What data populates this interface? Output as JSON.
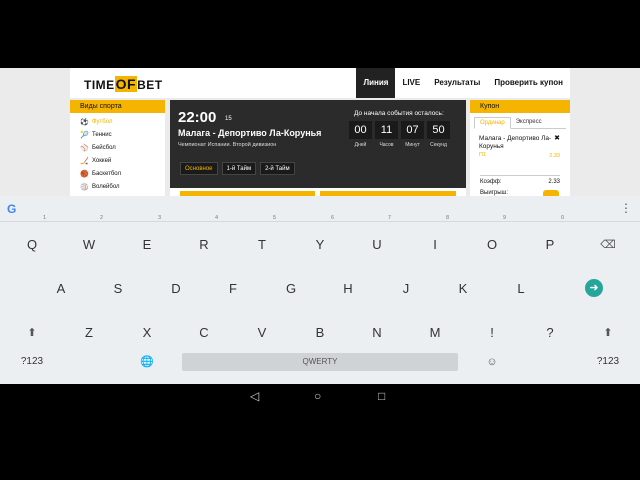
{
  "site": {
    "logo_pre": "TIME",
    "logo_mid": "OF",
    "logo_post": "BET",
    "nav": [
      "Линия",
      "LIVE",
      "Результаты",
      "Проверить купон"
    ]
  },
  "sidebar": {
    "title": "Виды спорта",
    "items": [
      {
        "icon": "soccer-ball-icon",
        "label": "Футбол"
      },
      {
        "icon": "tennis-icon",
        "label": "Теннис"
      },
      {
        "icon": "baseball-icon",
        "label": "Бейсбол"
      },
      {
        "icon": "hockey-icon",
        "label": "Хоккей"
      },
      {
        "icon": "basketball-icon",
        "label": "Баскетбол"
      },
      {
        "icon": "volleyball-icon",
        "label": "Волейбол"
      }
    ]
  },
  "match": {
    "time": "22:00",
    "day": "15",
    "teams": "Малага - Депортиво Ла-Корунья",
    "league": "Чемпионат Испании. Второй дивизион",
    "until_label": "До начала события осталось:",
    "countdown": [
      {
        "value": "00",
        "label": "Дней"
      },
      {
        "value": "11",
        "label": "Часов"
      },
      {
        "value": "07",
        "label": "Минут"
      },
      {
        "value": "50",
        "label": "Секунд"
      }
    ],
    "tabs": [
      "Основное",
      "1-й Тайм",
      "2-й Тайм"
    ]
  },
  "coupon": {
    "title": "Купон",
    "tabs": [
      "Ординар",
      "Экспресс"
    ],
    "bet_teams_line1": "Малага - Депортиво Ла-",
    "bet_teams_line2": "Корунья",
    "bet_selection": "П1",
    "bet_odds": "2.33",
    "coef_label": "Коэфф:",
    "coef_value": "2.33",
    "win_label": "Выигрыш:"
  },
  "keyboard": {
    "row1": [
      {
        "key": "Q",
        "hint": "1"
      },
      {
        "key": "W",
        "hint": "2"
      },
      {
        "key": "E",
        "hint": "3"
      },
      {
        "key": "R",
        "hint": "4"
      },
      {
        "key": "T",
        "hint": "5"
      },
      {
        "key": "Y",
        "hint": "6"
      },
      {
        "key": "U",
        "hint": "7"
      },
      {
        "key": "I",
        "hint": "8"
      },
      {
        "key": "O",
        "hint": "9"
      },
      {
        "key": "P",
        "hint": "0"
      }
    ],
    "row2": [
      "A",
      "S",
      "D",
      "F",
      "G",
      "H",
      "J",
      "K",
      "L"
    ],
    "row3": [
      "Z",
      "X",
      "C",
      "V",
      "B",
      "N",
      "M",
      "!",
      "?"
    ],
    "sym_left": "?123",
    "sym_right": "?123",
    "space_label": "QWERTY"
  },
  "colors": {
    "accent": "#f5b400",
    "dark": "#2b2b2b",
    "enter": "#26a69a"
  }
}
